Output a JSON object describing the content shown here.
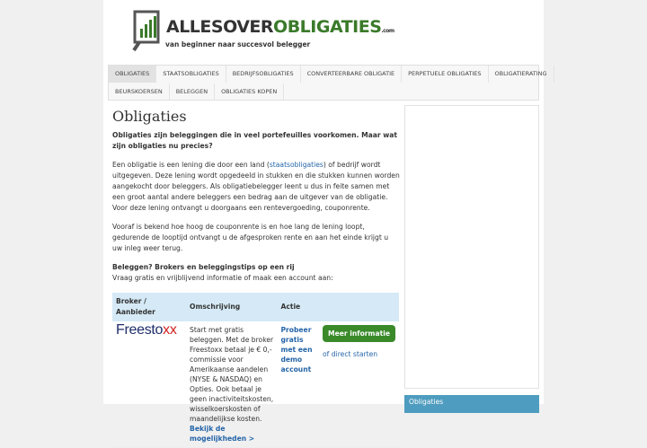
{
  "brand": {
    "title_part1": "ALLESOVER",
    "title_part2": "OBLIGATIES",
    "tld": ".com",
    "tagline": "van beginner naar succesvol belegger"
  },
  "nav": {
    "row1": [
      "Obligaties",
      "Staatsobligaties",
      "Bedrijfsobligaties",
      "Converteerbare obligatie",
      "Perpetuele obligaties",
      "Obligatierating"
    ],
    "row2": [
      "Beurskoersen",
      "Beleggen",
      "Obligaties kopen"
    ]
  },
  "article": {
    "title": "Obligaties",
    "intro": "Obligaties zijn beleggingen die in veel portefeuilles voorkomen. Maar wat zijn obligaties nu precies?",
    "p1_before": "Een obligatie is een lening die door een land (",
    "p1_link": "staatsobligaties",
    "p1_after": ") of bedrijf wordt uitgegeven. Deze lening wordt opgedeeld in stukken en die stukken kunnen worden aangekocht door beleggers. Als obligatiebelegger leent u dus in feite samen met een groot aantal andere beleggers een bedrag aan de uitgever van de obligatie. Voor deze lening ontvangt u doorgaans een rentevergoeding, couponrente.",
    "p2": "Vooraf is bekend hoe hoog de couponrente is en hoe lang de lening loopt, gedurende de looptijd ontvangt u de afgesproken rente en aan het einde krijgt u uw inleg weer terug.",
    "sub_heading": "Beleggen? Brokers en beleggingstips op een rij",
    "sub_text": "Vraag gratis en vrijblijvend informatie of maak een account aan:"
  },
  "broker_table": {
    "headers": [
      "Broker / Aanbieder",
      "Omschrijving",
      "Actie"
    ],
    "rows": [
      {
        "logo_part1": "Freesto",
        "logo_part2": "xx",
        "description": "Start met gratis beleggen. Met de broker Freestoxx betaal je € 0,- commissie voor Amerikaanse aandelen (NYSE & NASDAQ) en Opties. Ook betaal je geen inactiviteitskosten, wisselkoerskosten of maandelijkse kosten.",
        "desc_link": "Bekijk de mogelijkheden >",
        "action_link": "Probeer gratis met een demo account",
        "button": "Meer informatie",
        "direct": "of direct starten"
      }
    ]
  },
  "sidebar": {
    "tab_label": "Obligaties"
  },
  "colors": {
    "accent_green": "#3a8a2a",
    "link_blue": "#2565a8",
    "table_header": "#d5eaf6",
    "sidebar_tab": "#4e9cbf"
  }
}
